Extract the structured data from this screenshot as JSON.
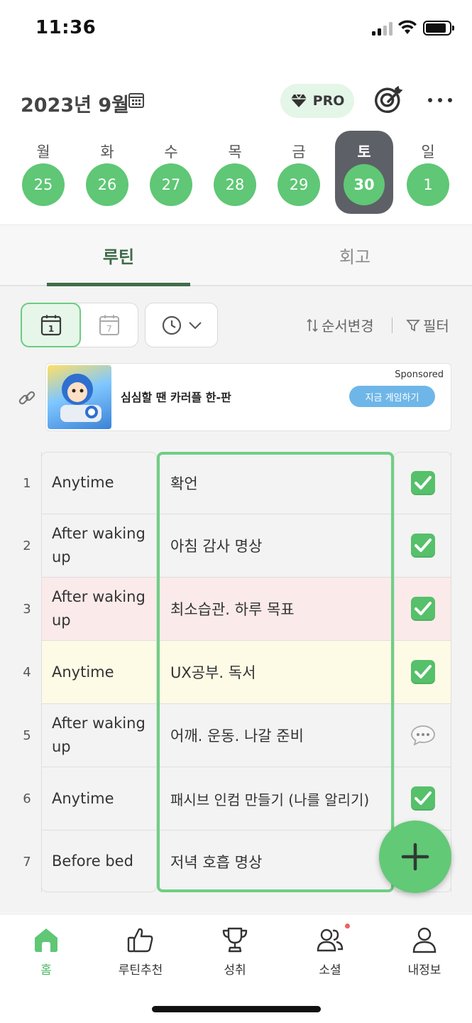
{
  "status_bar": {
    "time": "11:36"
  },
  "header": {
    "month_title": "2023년 9월",
    "pro_label": "PRO"
  },
  "week": [
    {
      "name": "월",
      "date": "25",
      "selected": false
    },
    {
      "name": "화",
      "date": "26",
      "selected": false
    },
    {
      "name": "수",
      "date": "27",
      "selected": false
    },
    {
      "name": "목",
      "date": "28",
      "selected": false
    },
    {
      "name": "금",
      "date": "29",
      "selected": false
    },
    {
      "name": "토",
      "date": "30",
      "selected": true
    },
    {
      "name": "일",
      "date": "1",
      "selected": false
    }
  ],
  "tabs": [
    {
      "label": "루틴",
      "active": true
    },
    {
      "label": "회고",
      "active": false
    }
  ],
  "toolbar": {
    "day_view_number": "1",
    "week_view_number": "7",
    "sort_label": "순서변경",
    "filter_label": "필터"
  },
  "ad": {
    "text": "심심할 땐 카러플 한-판",
    "sponsored": "Sponsored",
    "cta": "지금 게임하기"
  },
  "routines": [
    {
      "num": "1",
      "time": "Anytime",
      "task": "확언",
      "status": "done",
      "highlight": "none"
    },
    {
      "num": "2",
      "time": "After waking up",
      "task": "아침 감사 명상",
      "status": "done",
      "highlight": "none"
    },
    {
      "num": "3",
      "time": "After waking up",
      "task": "최소습관. 하루 목표",
      "status": "done",
      "highlight": "pink"
    },
    {
      "num": "4",
      "time": "Anytime",
      "task": "UX공부. 독서",
      "status": "done",
      "highlight": "yellow"
    },
    {
      "num": "5",
      "time": "After waking up",
      "task": "어깨. 운동. 나갈 준비",
      "status": "comment",
      "highlight": "none"
    },
    {
      "num": "6",
      "time": "Anytime",
      "task": "패시브 인컴 만들기 (나를 알리기)",
      "status": "done",
      "highlight": "none"
    },
    {
      "num": "7",
      "time": "Before bed",
      "task": "저녁 호흡 명상",
      "status": "none",
      "highlight": "none"
    }
  ],
  "colors": {
    "accent_green": "#5fc775",
    "highlight_pink": "#fbeaea",
    "highlight_yellow": "#fdfbe6",
    "selected_day_bg": "#5d6066"
  },
  "bottom_nav": [
    {
      "label": "홈",
      "icon": "home-icon",
      "active": true
    },
    {
      "label": "루틴추천",
      "icon": "thumbs-up-icon",
      "active": false
    },
    {
      "label": "성취",
      "icon": "trophy-icon",
      "active": false
    },
    {
      "label": "소셜",
      "icon": "people-icon",
      "active": false
    },
    {
      "label": "내정보",
      "icon": "person-icon",
      "active": false
    }
  ]
}
